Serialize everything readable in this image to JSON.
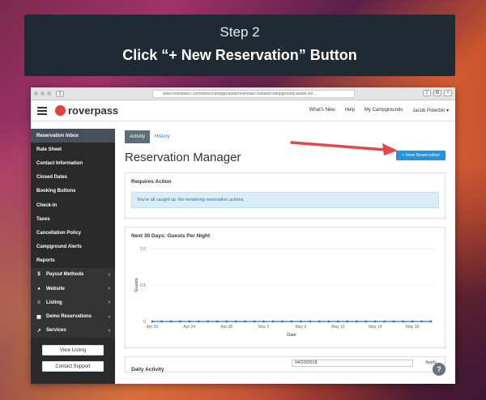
{
  "banner": {
    "step": "Step 2",
    "title": "Click “+ New Reservation” Button"
  },
  "browser": {
    "url": "www.roverpass.com/owner/campgrounds/roverpass-funland-campground-austin-tx/r..."
  },
  "nav": {
    "logo": "roverpass",
    "links": [
      "What's New",
      "Help",
      "My Campgrounds",
      "Jacob Poterbin ▾"
    ]
  },
  "sidebar": {
    "items": [
      {
        "label": "Reservation Inbox",
        "active": true
      },
      {
        "label": "Rate Sheet"
      },
      {
        "label": "Contact Information"
      },
      {
        "label": "Closed Dates"
      },
      {
        "label": "Booking Buttons"
      },
      {
        "label": "Check-In"
      },
      {
        "label": "Taxes"
      },
      {
        "label": "Cancellation Policy"
      },
      {
        "label": "Campground Alerts"
      },
      {
        "label": "Reports"
      }
    ],
    "groups": [
      {
        "label": "Payout Methods",
        "icon": "$"
      },
      {
        "label": "Website",
        "icon": "●"
      },
      {
        "label": "Listing",
        "icon": "≡"
      },
      {
        "label": "Demo Reservations",
        "icon": "▦"
      },
      {
        "label": "Services",
        "icon": "↗"
      }
    ],
    "view_listing": "View Listing",
    "contact_support": "Contact Support"
  },
  "main": {
    "tabs": [
      "Activity",
      "History"
    ],
    "title": "Reservation Manager",
    "new_button": "+ New Reservation",
    "requires_action": {
      "title": "Requires Action",
      "message": "You're all caught up. No remaining reservation actions."
    },
    "chart_title": "Next 30 Days: Guests Per Night",
    "daily": {
      "label": "Daily Activity",
      "date": "04/20/2018",
      "apply": "Apply"
    }
  },
  "chart_data": {
    "type": "line",
    "xlabel": "Date",
    "ylabel": "Guests",
    "ylim": [
      0,
      1.0
    ],
    "yticks": [
      "1.0",
      "0.5",
      "0"
    ],
    "x_tick_labels": [
      "Apr 20",
      "Apr 24",
      "Apr 28",
      "May 2",
      "May 6",
      "May 10",
      "May 14",
      "May 18"
    ],
    "series": [
      {
        "values": [
          0,
          0,
          0,
          0,
          0,
          0,
          0,
          0,
          0,
          0,
          0,
          0,
          0,
          0,
          0,
          0,
          0,
          0,
          0,
          0,
          0,
          0,
          0,
          0,
          0,
          0,
          0,
          0,
          0,
          0,
          0
        ]
      }
    ],
    "color": "#2b78c2"
  },
  "help": "?",
  "colors": {
    "accent": "#2492dc",
    "arrow": "#e24848",
    "logo": "#e2423e"
  }
}
